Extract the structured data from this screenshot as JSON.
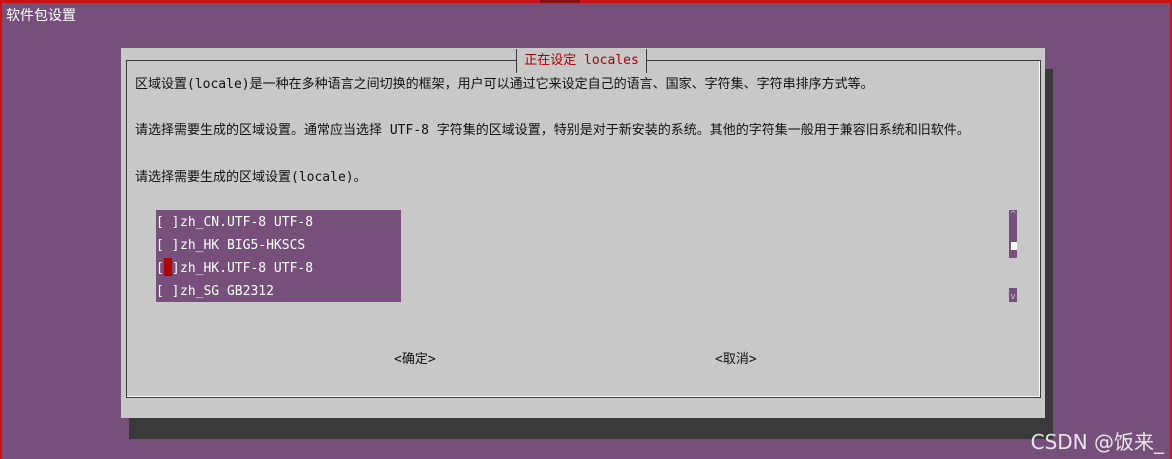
{
  "window": {
    "title": "软件包设置"
  },
  "dialog": {
    "title": "正在设定 locales",
    "description_1": "区域设置(locale)是一种在多种语言之间切换的框架，用户可以通过它来设定自己的语言、国家、字符集、字符串排序方式等。",
    "description_2": "请选择需要生成的区域设置。通常应当选择 UTF-8 字符集的区域设置，特别是对于新安装的系统。其他的字符集一般用于兼容旧系统和旧软件。",
    "prompt": "请选择需要生成的区域设置(locale)。"
  },
  "locale_list": {
    "items": [
      {
        "checkbox": "[ ]",
        "label": "zh_CN.UTF-8 UTF-8",
        "checked": false,
        "focused": false
      },
      {
        "checkbox": "[ ]",
        "label": "zh_HK BIG5-HKSCS",
        "checked": false,
        "focused": false
      },
      {
        "checkbox": "[ ]",
        "label": "zh_HK.UTF-8 UTF-8",
        "checked": false,
        "focused": true
      },
      {
        "checkbox": "[ ]",
        "label": "zh_SG GB2312",
        "checked": false,
        "focused": false
      }
    ]
  },
  "buttons": {
    "ok": "<确定>",
    "cancel": "<取消>"
  },
  "watermark": "CSDN @饭来_",
  "colors": {
    "background": "#76507a",
    "dialog": "#c8c8c8",
    "title_text": "#aa0000",
    "cursor": "#b00000"
  }
}
